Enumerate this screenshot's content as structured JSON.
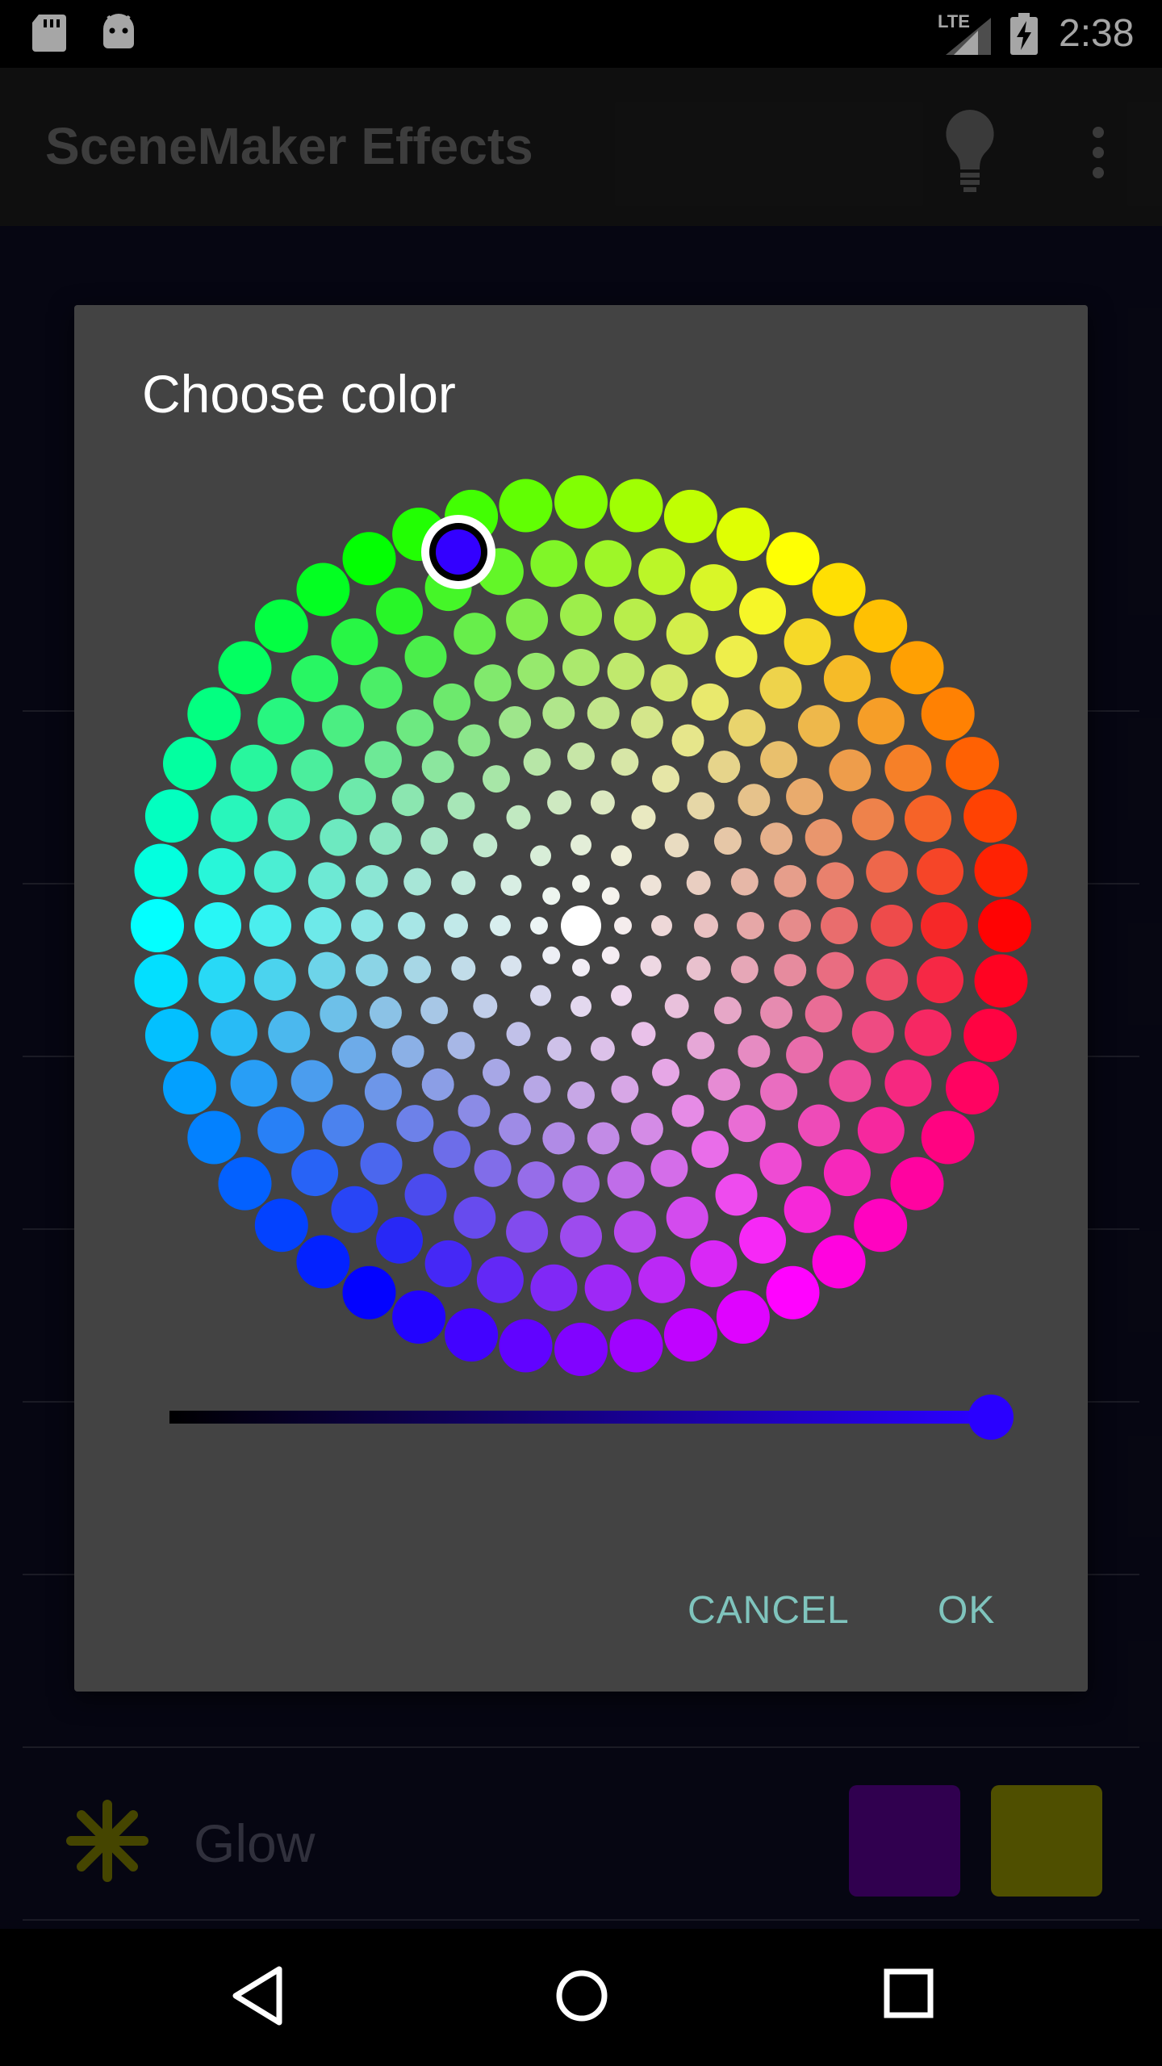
{
  "status_bar": {
    "network": "LTE",
    "time": "2:38",
    "icons": [
      "sd-card-icon",
      "android-icon",
      "signal-icon",
      "battery-charging-icon"
    ]
  },
  "app_bar": {
    "title": "SceneMaker Effects",
    "icons": [
      "lightbulb-icon",
      "more-vert-icon"
    ]
  },
  "background_list": {
    "visible_item": {
      "label": "Glow",
      "swatch_colors": [
        "#4a007a",
        "#7a7a00"
      ]
    }
  },
  "dialog": {
    "title": "Choose color",
    "selected_color": "#3300ff",
    "brightness_percent": 100,
    "cancel_label": "CANCEL",
    "ok_label": "OK"
  },
  "nav_bar": {
    "icons": [
      "back-icon",
      "home-icon",
      "recents-icon"
    ]
  }
}
